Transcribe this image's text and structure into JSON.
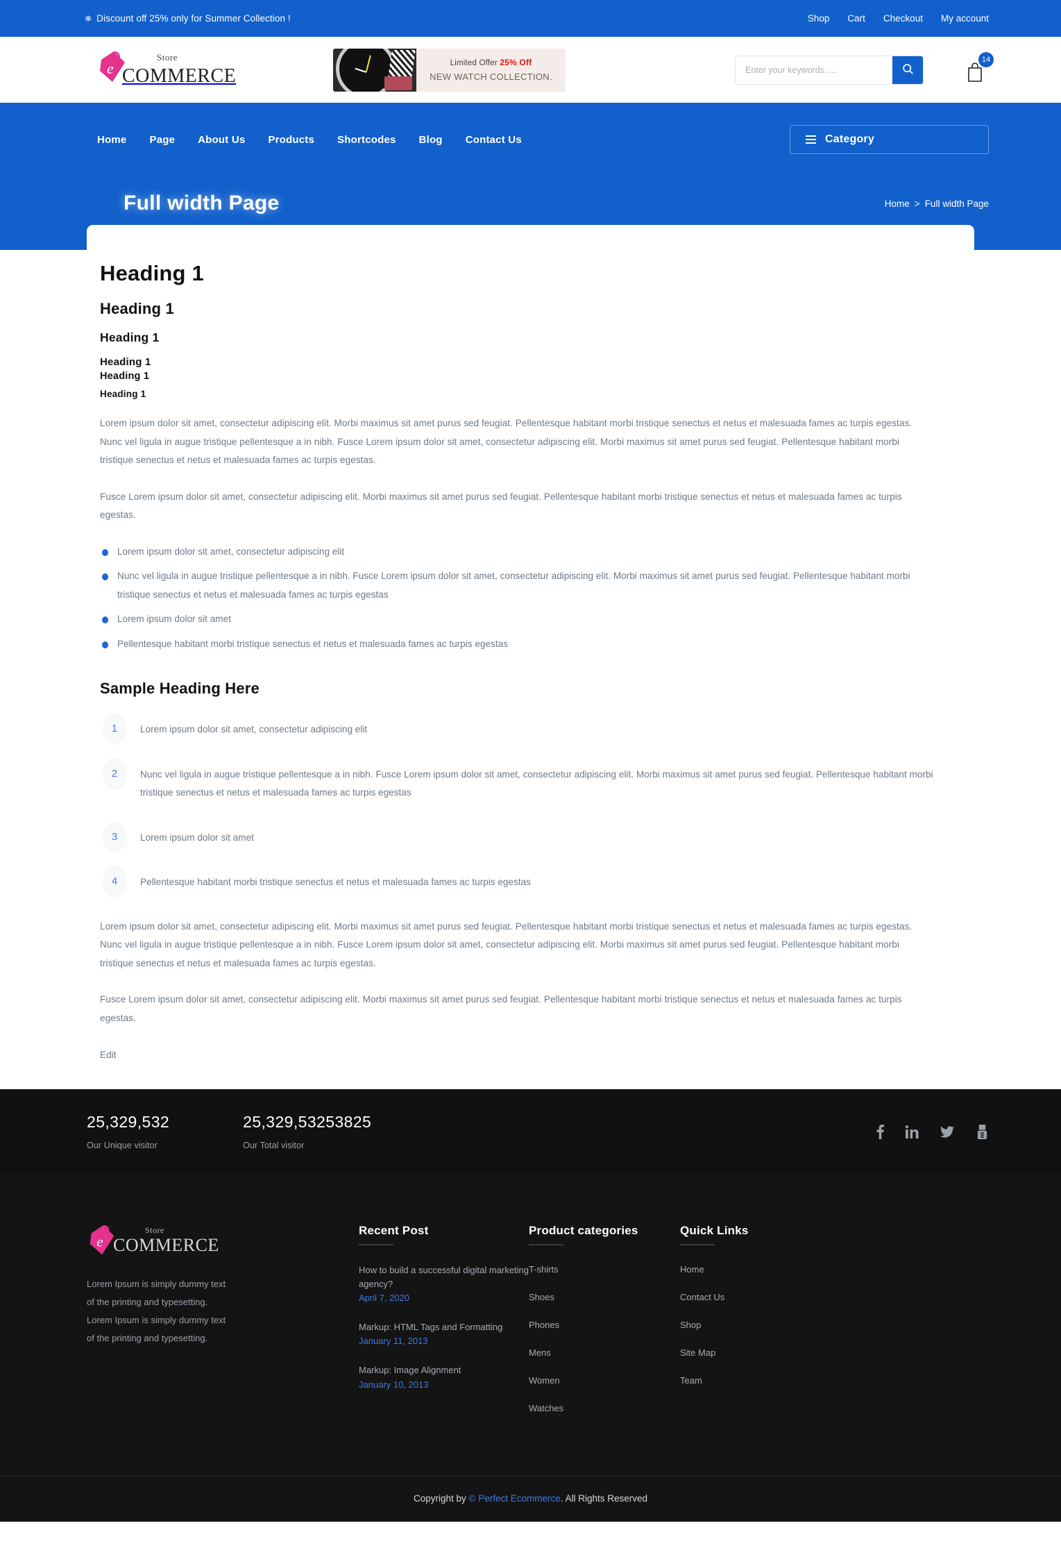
{
  "topbar": {
    "announcement": "Discount off 25% only for Summer Collection !",
    "snow_icon": "❄",
    "links": [
      {
        "label": "Shop"
      },
      {
        "label": "Cart"
      },
      {
        "label": "Checkout"
      },
      {
        "label": "My account"
      }
    ]
  },
  "header": {
    "logo": {
      "store": "Store",
      "commerce": "COMMERCE"
    },
    "promo": {
      "line1_prefix": "Limited Offer ",
      "line1_highlight": "25% Off",
      "line2": "NEW WATCH COLLECTION."
    },
    "search": {
      "placeholder": "Enter your keywords.....",
      "value": "",
      "icon": "search-icon"
    },
    "cart": {
      "count": "14",
      "icon": "shopping-bag-icon"
    }
  },
  "nav": {
    "items": [
      {
        "label": "Home"
      },
      {
        "label": "Page"
      },
      {
        "label": "About Us"
      },
      {
        "label": "Products"
      },
      {
        "label": "Shortcodes"
      },
      {
        "label": "Blog"
      },
      {
        "label": "Contact Us"
      }
    ],
    "category_button": {
      "label": "Category",
      "icon": "hamburger-icon"
    }
  },
  "hero": {
    "title": "Full width Page",
    "breadcrumb": {
      "home": "Home",
      "separator": ">",
      "current": "Full width Page"
    }
  },
  "content": {
    "headings": [
      {
        "level": "h1",
        "text": "Heading 1"
      },
      {
        "level": "h2",
        "text": "Heading 1"
      },
      {
        "level": "h3",
        "text": "Heading 1"
      },
      {
        "level": "h4",
        "text": "Heading 1"
      },
      {
        "level": "h5",
        "text": "Heading 1"
      },
      {
        "level": "h6",
        "text": "Heading 1"
      }
    ],
    "paragraph_1": "Lorem ipsum dolor sit amet, consectetur adipiscing elit. Morbi maximus sit amet purus sed feugiat. Pellentesque habitant morbi tristique senectus et netus et malesuada fames ac turpis egestas. Nunc vel ligula in augue tristique pellentesque a in nibh. Fusce Lorem ipsum dolor sit amet, consectetur adipiscing elit. Morbi maximus sit amet purus sed feugiat. Pellentesque habitant morbi tristique senectus et netus et malesuada fames ac turpis egestas.",
    "paragraph_2": "Fusce Lorem ipsum dolor sit amet, consectetur adipiscing elit. Morbi maximus sit amet purus sed feugiat. Pellentesque habitant morbi tristique senectus et netus et malesuada fames ac turpis egestas.",
    "bullets": [
      "Lorem ipsum dolor sit amet, consectetur adipiscing elit",
      "Nunc vel ligula in augue tristique pellentesque a in nibh. Fusce Lorem ipsum dolor sit amet, consectetur adipiscing elit. Morbi maximus sit amet purus sed feugiat. Pellentesque habitant morbi tristique senectus et netus et malesuada fames ac turpis egestas",
      "Lorem ipsum dolor sit amet",
      "Pellentesque habitant morbi tristique senectus et netus et malesuada fames ac turpis egestas"
    ],
    "sample_heading": "Sample Heading Here",
    "numbered": [
      {
        "num": "1",
        "text": "Lorem ipsum dolor sit amet, consectetur adipiscing elit"
      },
      {
        "num": "2",
        "text": "Nunc vel ligula in augue tristique pellentesque a in nibh. Fusce Lorem ipsum dolor sit amet, consectetur adipiscing elit. Morbi maximus sit amet purus sed feugiat. Pellentesque habitant morbi tristique senectus et netus et malesuada fames ac turpis egestas"
      },
      {
        "num": "3",
        "text": "Lorem ipsum dolor sit amet"
      },
      {
        "num": "4",
        "text": "Pellentesque habitant morbi tristique senectus et netus et malesuada fames ac turpis egestas"
      }
    ],
    "paragraph_3": "Lorem ipsum dolor sit amet, consectetur adipiscing elit. Morbi maximus sit amet purus sed feugiat. Pellentesque habitant morbi tristique senectus et netus et malesuada fames ac turpis egestas. Nunc vel ligula in augue tristique pellentesque a in nibh. Fusce Lorem ipsum dolor sit amet, consectetur adipiscing elit. Morbi maximus sit amet purus sed feugiat. Pellentesque habitant morbi tristique senectus et netus et malesuada fames ac turpis egestas.",
    "paragraph_4": "Fusce Lorem ipsum dolor sit amet, consectetur adipiscing elit. Morbi maximus sit amet purus sed feugiat. Pellentesque habitant morbi tristique senectus et netus et malesuada fames ac turpis egestas.",
    "edit_link": "Edit"
  },
  "counters": {
    "items": [
      {
        "value": "25,329,532",
        "label": "Our Unique visitor"
      },
      {
        "value": "25,329,53253825",
        "label": "Our Total visitor"
      }
    ],
    "socials": [
      {
        "name": "facebook-icon"
      },
      {
        "name": "linkedin-icon"
      },
      {
        "name": "twitter-icon"
      },
      {
        "name": "youtube-icon"
      }
    ]
  },
  "footer": {
    "brand": {
      "logo": {
        "store": "Store",
        "commerce": "COMMERCE"
      },
      "description": "Lorem Ipsum is simply dummy text of the printing and typesetting. Lorem Ipsum is simply dummy text of the printing and typesetting."
    },
    "recent": {
      "title": "Recent Post",
      "posts": [
        {
          "title": "How to build a successful digital marketing agency?",
          "date": "April 7, 2020"
        },
        {
          "title": "Markup: HTML Tags and Formatting",
          "date": "January 11, 2013"
        },
        {
          "title": "Markup: Image Alignment",
          "date": "January 10, 2013"
        }
      ]
    },
    "categories": {
      "title": "Product categories",
      "items": [
        {
          "label": "T-shirts"
        },
        {
          "label": "Shoes"
        },
        {
          "label": "Phones"
        },
        {
          "label": "Mens"
        },
        {
          "label": "Women"
        },
        {
          "label": "Watches"
        }
      ]
    },
    "quicklinks": {
      "title": "Quick Links",
      "items": [
        {
          "label": "Home"
        },
        {
          "label": "Contact Us"
        },
        {
          "label": "Shop"
        },
        {
          "label": "Site Map"
        },
        {
          "label": "Team"
        }
      ]
    },
    "copyright": {
      "prefix": "Copyright by ",
      "link": "© Perfect Ecommerce",
      "suffix": ". All Rights Reserved"
    }
  },
  "colors": {
    "brand_blue": "#1160cb",
    "accent_pink": "#e5328d",
    "link_blue": "#3d7ae0",
    "dark": "#111111",
    "promo_red": "#e8120f"
  }
}
